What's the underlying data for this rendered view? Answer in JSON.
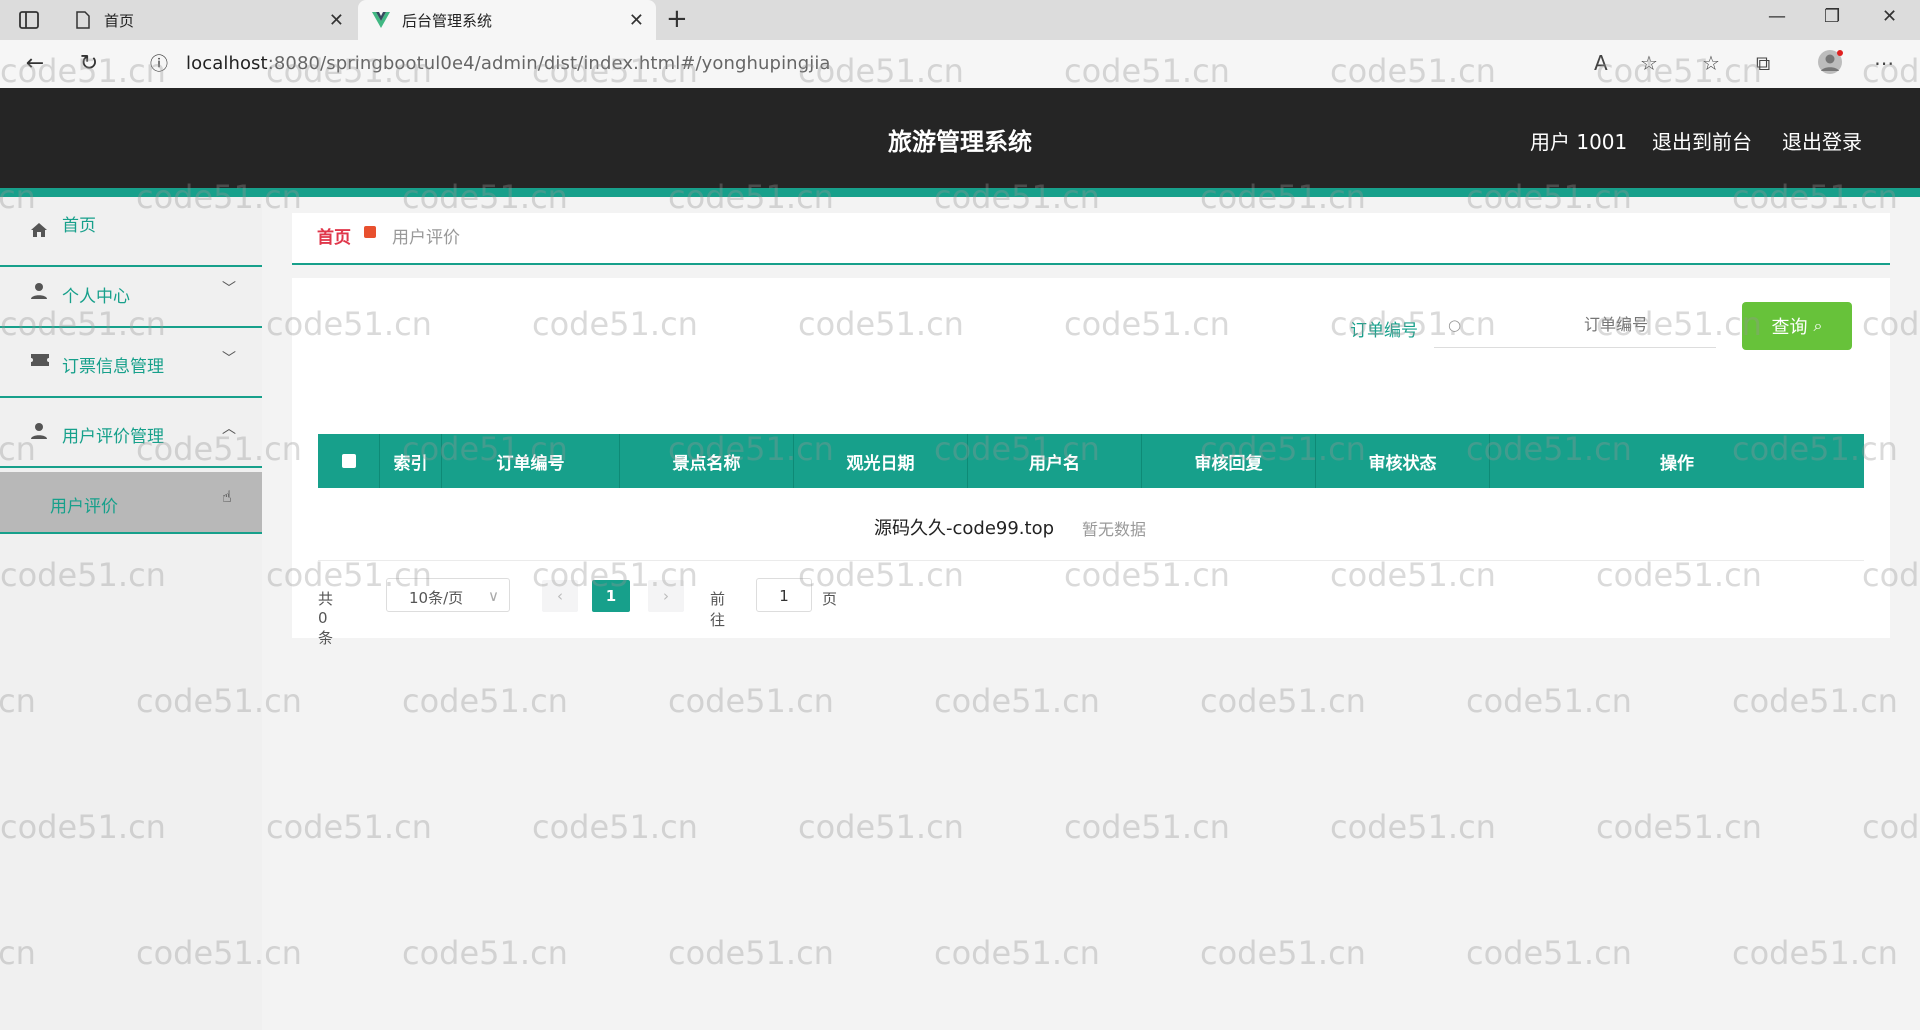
{
  "browser": {
    "tabs": [
      {
        "label": "首页",
        "icon": "page-icon"
      },
      {
        "label": "后台管理系统",
        "icon": "vue-logo-icon"
      }
    ],
    "url_host": "localhost",
    "url_rest": ":8080/springbootul0e4/admin/dist/index.html#/yonghupingjia"
  },
  "header": {
    "title": "旅游管理系统",
    "user": "用户 1001",
    "back_to_front": "退出到前台",
    "logout": "退出登录"
  },
  "sidebar": {
    "items": [
      {
        "label": "首页",
        "icon": "home-icon"
      },
      {
        "label": "个人中心",
        "icon": "user-icon"
      },
      {
        "label": "订票信息管理",
        "icon": "ticket-icon"
      },
      {
        "label": "用户评价管理",
        "icon": "user-icon"
      }
    ],
    "sub_item": "用户评价"
  },
  "breadcrumb": {
    "home": "首页",
    "current": "用户评价"
  },
  "search": {
    "label": "订单编号",
    "placeholder": "订单编号",
    "button": "查询"
  },
  "table": {
    "columns": [
      "索引",
      "订单编号",
      "景点名称",
      "观光日期",
      "用户名",
      "审核回复",
      "审核状态",
      "操作"
    ],
    "empty_overlay": "源码久久-code99.top",
    "empty_text": "暂无数据"
  },
  "pagination": {
    "total": "共 0 条",
    "page_size": "10条/页",
    "current_page": "1",
    "goto_label": "前往",
    "goto_value": "1",
    "goto_unit": "页"
  },
  "watermark": "code51.cn",
  "colors": {
    "accent": "#17a08b",
    "header_bg": "#252525",
    "query_button": "#67c23a",
    "breadcrumb_home": "#e0364a"
  }
}
